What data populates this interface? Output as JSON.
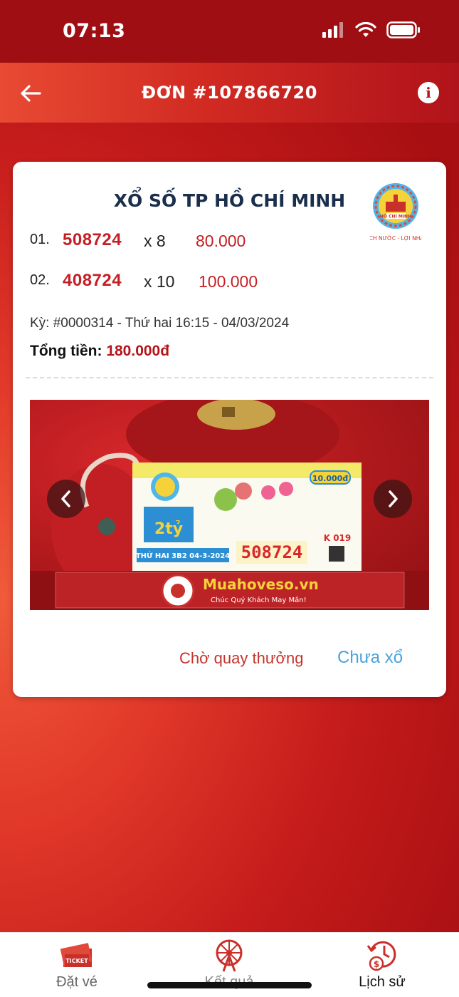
{
  "status_bar": {
    "time": "07:13"
  },
  "header": {
    "title": "ĐƠN #107866720"
  },
  "card": {
    "title": "XỔ SỐ TP HỒ CHÍ MINH",
    "logo_text": {
      "top": "XỔ SỐ KIẾN THIẾT",
      "middle": "HỒ CHÍ MINH",
      "bottom": "ÍCH NƯỚC - LỢI NHÀ"
    },
    "tickets": [
      {
        "index": "01.",
        "number": "508724",
        "qty": "x 8",
        "amount": "80.000"
      },
      {
        "index": "02.",
        "number": "408724",
        "qty": "x 10",
        "amount": "100.000"
      }
    ],
    "ky": "Kỳ: #0000314 - Thứ hai 16:15 - 04/03/2024",
    "total_label": "Tổng tiền:",
    "total_value": "180.000đ",
    "photo": {
      "ticket_price": "10.000đ",
      "ticket_prize": "2tỷ",
      "ticket_number": "508724",
      "ticket_date": "THỨ HAI 3B2 04-3-2024",
      "ticket_series": "K 019",
      "brand": "Muahoveso.vn",
      "slogan": "Chúc Quý Khách May Mắn!"
    },
    "status_primary": "Chờ quay thưởng",
    "status_secondary": "Chưa xổ"
  },
  "tabbar": {
    "items": [
      {
        "label": "Đặt vé",
        "icon": "ticket-icon"
      },
      {
        "label": "Kết quả",
        "icon": "ferris-wheel-icon"
      },
      {
        "label": "Lịch sử",
        "icon": "history-money-icon"
      }
    ]
  },
  "colors": {
    "brand_red": "#c41f24",
    "header_red": "#b0131a",
    "status_blue": "#4aa3dc",
    "title_navy": "#1b2f4d"
  }
}
